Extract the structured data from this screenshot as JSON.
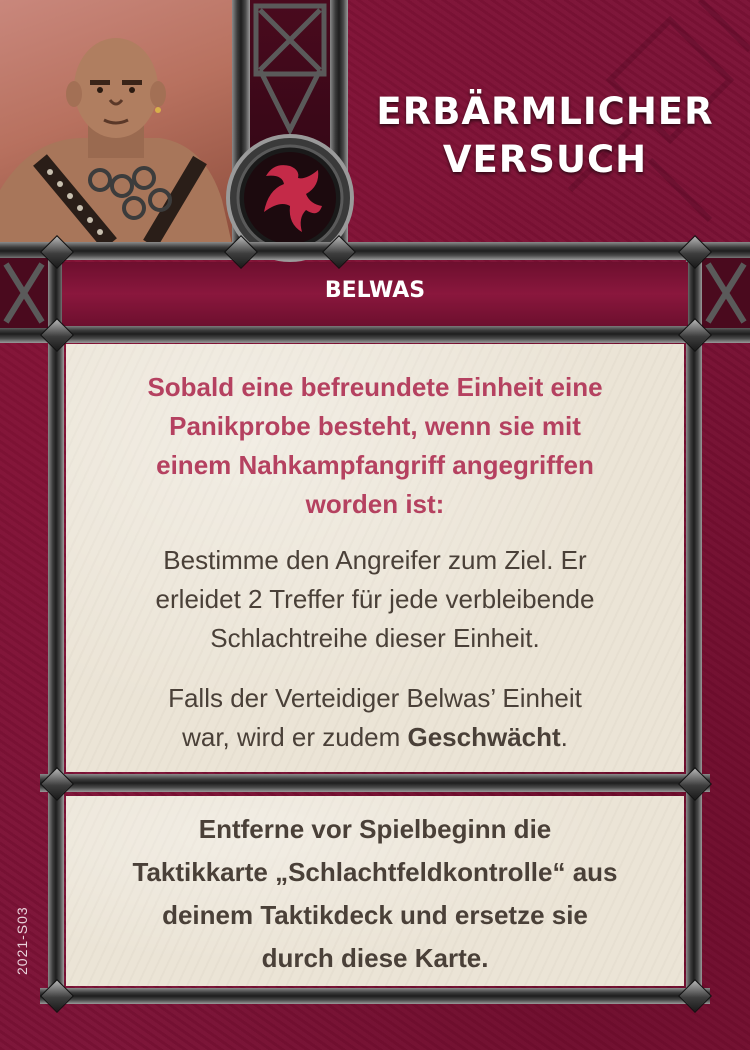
{
  "card": {
    "title_lines": [
      "ERBÄRMLICHER",
      "VERSUCH"
    ],
    "character": "BELWAS",
    "trigger_lines": [
      "Sobald eine befreundete Einheit eine",
      "Panikprobe besteht, wenn sie mit",
      "einem Nahkampfangriff angegriffen",
      "worden ist:"
    ],
    "effect_lines": [
      "Bestimme den Angreifer zum Ziel. Er",
      "erleidet 2 Treffer für jede verbleibende",
      "Schlachtreihe dieser Einheit."
    ],
    "effect2_line1": "Falls der Verteidiger Belwas’ Einheit",
    "effect2_line2_prefix": "war, wird er zudem ",
    "effect2_bold": "Geschwächt",
    "effect2_suffix": ".",
    "setup_lines": [
      "Entferne vor Spielbeginn die",
      "Taktikkarte „Schlachtfeldkontrolle“ aus",
      "deinem Taktikdeck und ersetze sie",
      "durch diese Karte."
    ],
    "card_code": "2021-S03"
  },
  "icons": {
    "faction_emblem": "dragon-icon",
    "portrait": "belwas-portrait"
  },
  "colors": {
    "background": "#7c1236",
    "trigger_text": "#b54160",
    "body_text": "#4a4038",
    "emblem_red": "#c42a48"
  }
}
